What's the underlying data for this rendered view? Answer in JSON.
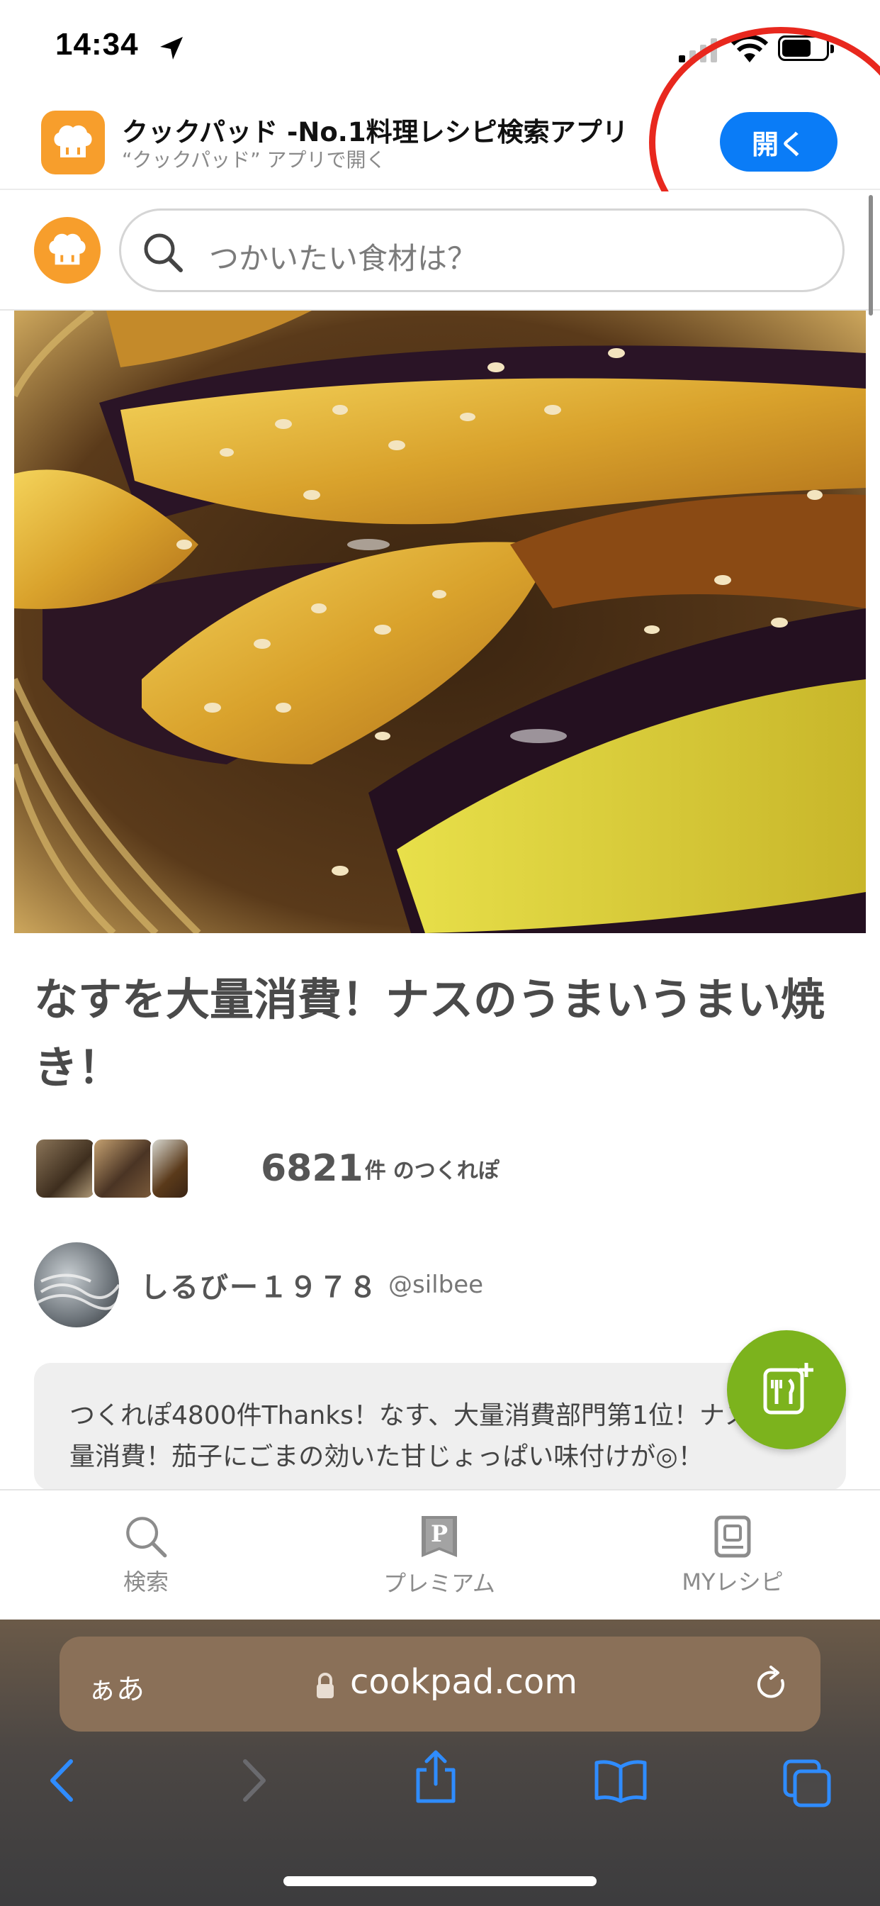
{
  "status_bar": {
    "time": "14:34"
  },
  "app_banner": {
    "title": "クックパッド -No.1料理レシピ検索アプリ",
    "subtitle": "“クックパッド” アプリで開く",
    "open_label": "開く"
  },
  "search": {
    "placeholder": "つかいたい食材は？"
  },
  "recipe": {
    "title": "なすを大量消費！ナスのうまいうまい焼き！",
    "tsukurepo_count": "6821",
    "tsukurepo_unit": "件",
    "tsukurepo_label": "のつくれぽ",
    "author_name": "しるびー１９７８",
    "author_handle": "@silbee",
    "description": "つくれぽ4800件Thanks！なす、大量消費部門第1位！ナスを大量消費！茄子にごまの効いた甘じょっぱい味付けが◎！"
  },
  "site_tabs": [
    {
      "label": "検索",
      "icon": "search-icon"
    },
    {
      "label": "プレミアム",
      "icon": "premium-icon"
    },
    {
      "label": "MYレシピ",
      "icon": "my-recipe-icon"
    }
  ],
  "safari": {
    "aa_label": "ぁあ",
    "url": "cookpad.com"
  },
  "colors": {
    "brand_orange": "#f79e2c",
    "ios_blue": "#0a7cf7",
    "fab_green": "#7cb31d",
    "annotation_red": "#e8281e"
  }
}
